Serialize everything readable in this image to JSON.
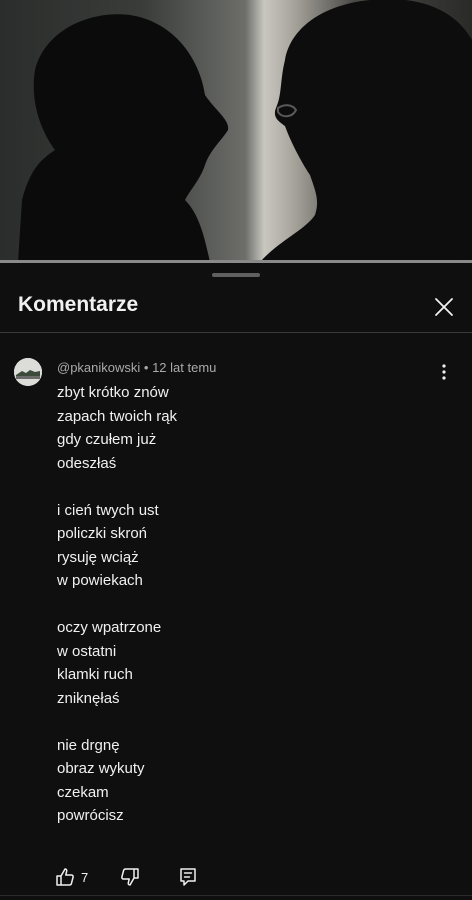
{
  "panel": {
    "title": "Komentarze"
  },
  "comment": {
    "author": "@pkanikowski",
    "separator": " • ",
    "time": "12 lat temu",
    "text": "zbyt krótko znów\nzapach twoich rąk\ngdy czułem już\nodeszłaś\n\ni cień twych ust\npoliczki skroń\nrysuję wciąż\nw powiekach\n\noczy wpatrzone\nw ostatni\nklamki ruch\nzniknęłaś\n\nnie drgnę\nobraz wykuty\nczekam\npowrócisz",
    "likes": "7"
  },
  "icons": {
    "close": "close-icon",
    "more": "more-vert-icon",
    "like": "thumb-up-icon",
    "dislike": "thumb-down-icon",
    "reply": "reply-icon"
  },
  "colors": {
    "background": "#0f0f0f",
    "text": "#f1f1f1",
    "secondary_text": "#aaaaaa"
  }
}
